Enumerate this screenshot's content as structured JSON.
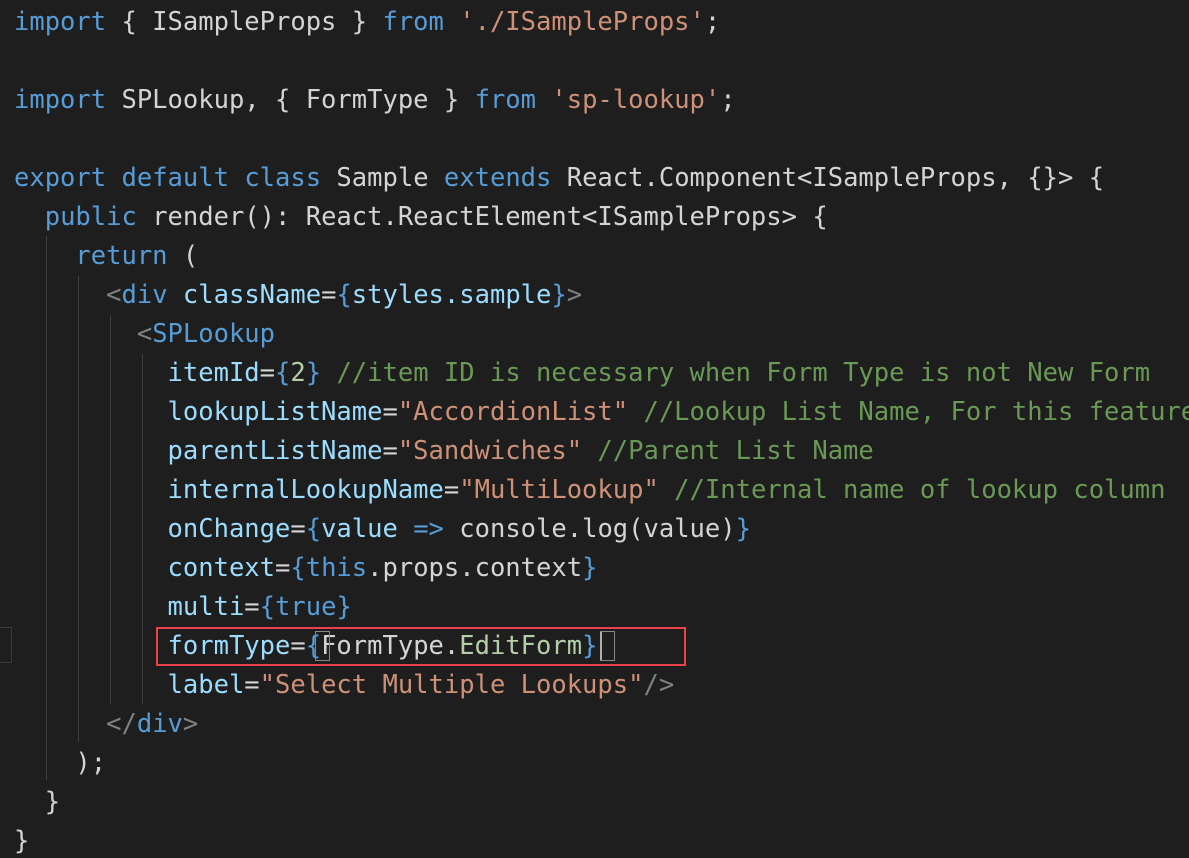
{
  "theme": {
    "background": "#1e1e1e",
    "keyword_blue": "#569cd6",
    "control_purple": "#c586c0",
    "string_orange": "#ce9178",
    "comment_green": "#6a9955",
    "attribute_cyan": "#9cdcfe",
    "type_teal": "#4ec9b0",
    "function_yellow": "#dcdcaa",
    "number_green": "#b5cea8",
    "tag_gray": "#808080",
    "default_text": "#d4d4d4",
    "highlight_border": "#e8424a"
  },
  "code": {
    "lines": [
      [
        {
          "t": "import",
          "c": "kw"
        },
        {
          "t": " { ISampleProps } ",
          "c": "tx"
        },
        {
          "t": "from",
          "c": "kw"
        },
        {
          "t": " ",
          "c": "tx"
        },
        {
          "t": "'./ISampleProps'",
          "c": "str"
        },
        {
          "t": ";",
          "c": "tx"
        }
      ],
      [],
      [
        {
          "t": "import",
          "c": "kw"
        },
        {
          "t": " SPLookup, { FormType } ",
          "c": "tx"
        },
        {
          "t": "from",
          "c": "kw"
        },
        {
          "t": " ",
          "c": "tx"
        },
        {
          "t": "'sp-lookup'",
          "c": "str"
        },
        {
          "t": ";",
          "c": "tx"
        }
      ],
      [],
      [
        {
          "t": "export",
          "c": "kw"
        },
        {
          "t": " ",
          "c": "tx"
        },
        {
          "t": "default",
          "c": "kw"
        },
        {
          "t": " ",
          "c": "tx"
        },
        {
          "t": "class",
          "c": "kw"
        },
        {
          "t": " Sample ",
          "c": "tx"
        },
        {
          "t": "extends",
          "c": "kw"
        },
        {
          "t": " React.Component<ISampleProps, {}> {",
          "c": "tx"
        }
      ],
      [
        {
          "t": "  ",
          "c": "tx"
        },
        {
          "t": "public",
          "c": "kw"
        },
        {
          "t": " render(): React.ReactElement<ISampleProps> {",
          "c": "tx"
        }
      ],
      [
        {
          "t": "    ",
          "c": "tx"
        },
        {
          "t": "return",
          "c": "kw"
        },
        {
          "t": " (",
          "c": "tx"
        }
      ],
      [
        {
          "t": "      ",
          "c": "tx"
        },
        {
          "t": "<",
          "c": "tag"
        },
        {
          "t": "div",
          "c": "kw"
        },
        {
          "t": " ",
          "c": "tx"
        },
        {
          "t": "className",
          "c": "attr"
        },
        {
          "t": "=",
          "c": "tx"
        },
        {
          "t": "{",
          "c": "kw"
        },
        {
          "t": "styles.sample",
          "c": "attr"
        },
        {
          "t": "}",
          "c": "kw"
        },
        {
          "t": ">",
          "c": "tag"
        }
      ],
      [
        {
          "t": "        ",
          "c": "tx"
        },
        {
          "t": "<",
          "c": "tag"
        },
        {
          "t": "SPLookup",
          "c": "kw"
        }
      ],
      [
        {
          "t": "          ",
          "c": "tx"
        },
        {
          "t": "itemId",
          "c": "attr"
        },
        {
          "t": "=",
          "c": "tx"
        },
        {
          "t": "{",
          "c": "kw"
        },
        {
          "t": "2",
          "c": "num"
        },
        {
          "t": "}",
          "c": "kw"
        },
        {
          "t": " //item ID is necessary when Form Type is not New Form",
          "c": "cmt"
        }
      ],
      [
        {
          "t": "          ",
          "c": "tx"
        },
        {
          "t": "lookupListName",
          "c": "attr"
        },
        {
          "t": "=",
          "c": "tx"
        },
        {
          "t": "\"AccordionList\"",
          "c": "str"
        },
        {
          "t": " //Lookup List Name, For this feature",
          "c": "cmt"
        }
      ],
      [
        {
          "t": "          ",
          "c": "tx"
        },
        {
          "t": "parentListName",
          "c": "attr"
        },
        {
          "t": "=",
          "c": "tx"
        },
        {
          "t": "\"Sandwiches\"",
          "c": "str"
        },
        {
          "t": " //Parent List Name",
          "c": "cmt"
        }
      ],
      [
        {
          "t": "          ",
          "c": "tx"
        },
        {
          "t": "internalLookupName",
          "c": "attr"
        },
        {
          "t": "=",
          "c": "tx"
        },
        {
          "t": "\"MultiLookup\"",
          "c": "str"
        },
        {
          "t": " //Internal name of lookup column",
          "c": "cmt"
        }
      ],
      [
        {
          "t": "          ",
          "c": "tx"
        },
        {
          "t": "onChange",
          "c": "attr"
        },
        {
          "t": "=",
          "c": "tx"
        },
        {
          "t": "{",
          "c": "kw"
        },
        {
          "t": "value ",
          "c": "attr"
        },
        {
          "t": "=>",
          "c": "kw"
        },
        {
          "t": " console.log(value)",
          "c": "tx"
        },
        {
          "t": "}",
          "c": "kw"
        }
      ],
      [
        {
          "t": "          ",
          "c": "tx"
        },
        {
          "t": "context",
          "c": "attr"
        },
        {
          "t": "=",
          "c": "tx"
        },
        {
          "t": "{",
          "c": "kw"
        },
        {
          "t": "this",
          "c": "kw"
        },
        {
          "t": ".props.context",
          "c": "tx"
        },
        {
          "t": "}",
          "c": "kw"
        }
      ],
      [
        {
          "t": "          ",
          "c": "tx"
        },
        {
          "t": "multi",
          "c": "attr"
        },
        {
          "t": "=",
          "c": "tx"
        },
        {
          "t": "{",
          "c": "kw"
        },
        {
          "t": "true",
          "c": "kw"
        },
        {
          "t": "}",
          "c": "kw"
        }
      ],
      [
        {
          "t": "          ",
          "c": "tx"
        },
        {
          "t": "formType",
          "c": "attr"
        },
        {
          "t": "=",
          "c": "tx"
        },
        {
          "t": "{",
          "c": "kw"
        },
        {
          "t": "FormType.",
          "c": "tx"
        },
        {
          "t": "EditForm",
          "c": "num"
        },
        {
          "t": "}",
          "c": "kw"
        }
      ],
      [
        {
          "t": "          ",
          "c": "tx"
        },
        {
          "t": "label",
          "c": "attr"
        },
        {
          "t": "=",
          "c": "tx"
        },
        {
          "t": "\"Select Multiple Lookups\"",
          "c": "str"
        },
        {
          "t": "/>",
          "c": "tag"
        }
      ],
      [
        {
          "t": "      ",
          "c": "tx"
        },
        {
          "t": "</",
          "c": "tag"
        },
        {
          "t": "div",
          "c": "kw"
        },
        {
          "t": ">",
          "c": "tag"
        }
      ],
      [
        {
          "t": "    );",
          "c": "tx"
        }
      ],
      [
        {
          "t": "  }",
          "c": "tx"
        }
      ],
      [
        {
          "t": "}",
          "c": "tx"
        }
      ]
    ]
  }
}
